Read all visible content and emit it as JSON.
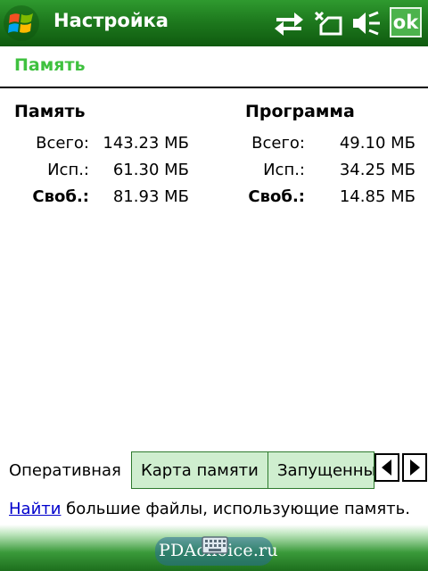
{
  "titlebar": {
    "title": "Настройка",
    "ok_label": "ok"
  },
  "section": {
    "title": "Память"
  },
  "memory": {
    "heading": "Память",
    "total_label": "Всего:",
    "total_value": "143.23 МБ",
    "used_label": "Исп.:",
    "used_value": "61.30 МБ",
    "free_label": "Своб.:",
    "free_value": "81.93 МБ"
  },
  "program": {
    "heading": "Программа",
    "total_label": "Всего:",
    "total_value": "49.10 МБ",
    "used_label": "Исп.:",
    "used_value": "34.25 МБ",
    "free_label": "Своб.:",
    "free_value": "14.85 МБ"
  },
  "tabs": [
    {
      "label": "Оперативная",
      "active": true
    },
    {
      "label": "Карта памяти",
      "active": false
    },
    {
      "label": "Запущенные",
      "active": false
    }
  ],
  "hint": {
    "link": "Найти",
    "text": " большие файлы, использующие память."
  },
  "watermark": "PDAchoice.ru",
  "colors": {
    "accent_green": "#3fc13f",
    "titlebar_green": "#1e7a1e",
    "link_blue": "#0000cc"
  },
  "icons": [
    "windows-start-icon",
    "connectivity-icon",
    "battery-icon",
    "volume-muted-icon",
    "keyboard-icon",
    "arrow-left-icon",
    "arrow-right-icon"
  ]
}
